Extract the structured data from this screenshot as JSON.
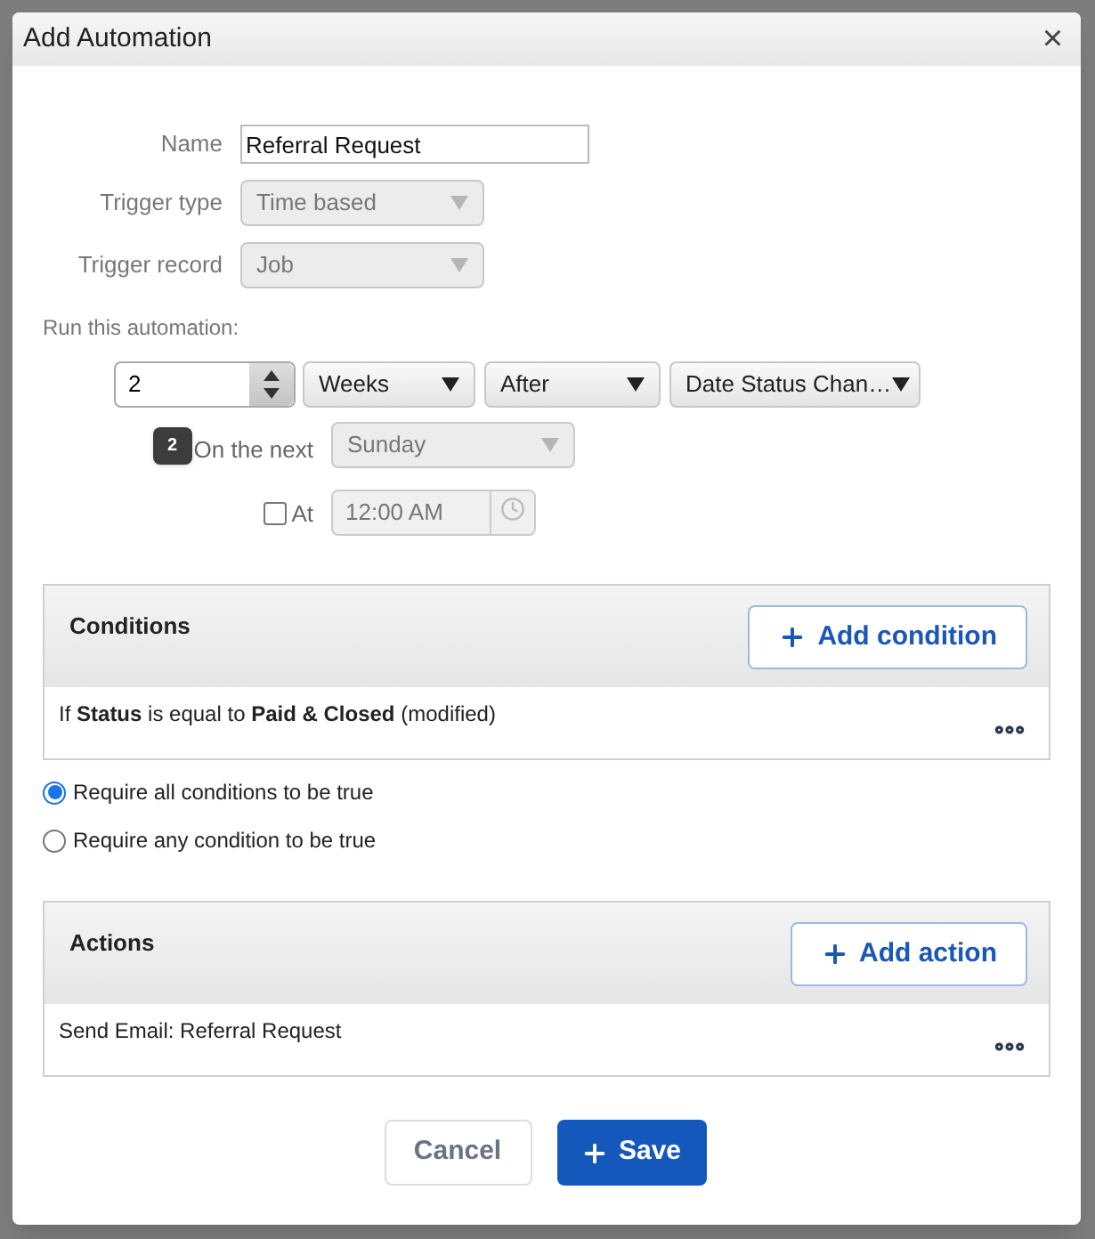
{
  "dialog": {
    "title": "Add Automation",
    "close": "×"
  },
  "fields": [
    {
      "kind": "text",
      "label": "Name",
      "value": "Referral Request"
    },
    {
      "kind": "select",
      "label": "Trigger type",
      "value": "Time based",
      "disabled": true
    },
    {
      "kind": "select",
      "label": "Trigger record",
      "value": "Job",
      "disabled": true
    }
  ],
  "schedule": {
    "label": "Run this automation:",
    "amount": "2",
    "unit": "Weeks",
    "relation": "After",
    "anchor": "Date Status Chan…",
    "tooltip": "2",
    "on_the_next": {
      "label": "On the next",
      "value": "Sunday",
      "disabled": true
    },
    "at": {
      "label": "At",
      "checked": false,
      "time": "12:00 AM"
    }
  },
  "conditions": {
    "title": "Conditions",
    "add_button": "Add condition",
    "rows": [
      {
        "text": "If **Status** is equal to **Paid & Closed** (modified)"
      }
    ]
  },
  "match_options": [
    {
      "label": "Require all conditions to be true",
      "selected": true
    },
    {
      "label": "Require any condition to be true",
      "selected": false
    }
  ],
  "actions": {
    "title": "Actions",
    "add_button": "Add action",
    "rows": [
      {
        "text": "Send Email: Referral Request"
      }
    ]
  },
  "buttons": {
    "cancel": "Cancel",
    "save": "Save"
  }
}
